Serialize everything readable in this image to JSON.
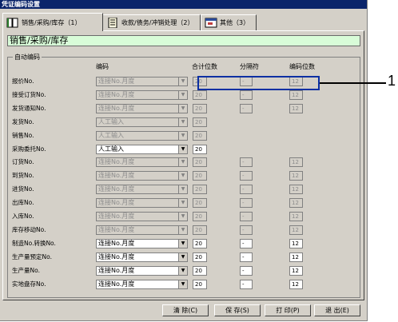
{
  "title": "凭证编码设置",
  "tabs": [
    {
      "label": "销售/采购/库存（1）",
      "icon": "book-icon",
      "active": true
    },
    {
      "label": "收款/债务/冲销处理（2）",
      "icon": "notebook-icon",
      "active": false
    },
    {
      "label": "其他（3）",
      "icon": "window-icon",
      "active": false
    }
  ],
  "section_title": "销售/采购/库存",
  "group_label": "自动编码",
  "columns": {
    "code": "编码",
    "total": "合计位数",
    "sep": "分隔符",
    "len": "编码位数"
  },
  "rows": [
    {
      "label": "报价No.",
      "code": "连接No.月度",
      "total": "20",
      "sep": "-",
      "len": "12",
      "enabled": false
    },
    {
      "label": "接受订货No.",
      "code": "连接No.月度",
      "total": "20",
      "sep": "-",
      "len": "12",
      "enabled": false
    },
    {
      "label": "发货通知No.",
      "code": "连接No.月度",
      "total": "20",
      "sep": "-",
      "len": "12",
      "enabled": false
    },
    {
      "label": "发货No.",
      "code": "人工输入",
      "total": "20",
      "sep": "",
      "len": "",
      "enabled": false
    },
    {
      "label": "销售No.",
      "code": "人工输入",
      "total": "20",
      "sep": "",
      "len": "",
      "enabled": false
    },
    {
      "label": "采购委托No.",
      "code": "人工输入",
      "total": "20",
      "sep": "",
      "len": "",
      "enabled": true
    },
    {
      "label": "订货No.",
      "code": "连接No.月度",
      "total": "20",
      "sep": "-",
      "len": "12",
      "enabled": false
    },
    {
      "label": "到货No.",
      "code": "连接No.月度",
      "total": "20",
      "sep": "-",
      "len": "12",
      "enabled": false
    },
    {
      "label": "进货No.",
      "code": "连接No.月度",
      "total": "20",
      "sep": "-",
      "len": "12",
      "enabled": false
    },
    {
      "label": "出库No.",
      "code": "连接No.月度",
      "total": "20",
      "sep": "-",
      "len": "12",
      "enabled": false
    },
    {
      "label": "入库No.",
      "code": "连接No.月度",
      "total": "20",
      "sep": "-",
      "len": "12",
      "enabled": false
    },
    {
      "label": "库存移动No.",
      "code": "连接No.月度",
      "total": "20",
      "sep": "-",
      "len": "12",
      "enabled": false
    },
    {
      "label": "制造No.转换No.",
      "code": "连接No.月度",
      "total": "20",
      "sep": "-",
      "len": "12",
      "enabled": true
    },
    {
      "label": "生产量预定No.",
      "code": "连接No.月度",
      "total": "20",
      "sep": "-",
      "len": "12",
      "enabled": true
    },
    {
      "label": "生产量No.",
      "code": "连接No.月度",
      "total": "20",
      "sep": "-",
      "len": "12",
      "enabled": true
    },
    {
      "label": "实地盘存No.",
      "code": "连接No.月度",
      "total": "20",
      "sep": "-",
      "len": "12",
      "enabled": true
    }
  ],
  "buttons": {
    "clear": "清 除(C)",
    "save": "保 存(S)",
    "print": "打 印(P)",
    "exit": "退 出(E)"
  },
  "callout": "1",
  "colors": {
    "title_bar": "#0a246a",
    "section_bg": "#d8fcd8",
    "callout": "#0b2fa3",
    "window_bg": "#d4d0c8"
  }
}
